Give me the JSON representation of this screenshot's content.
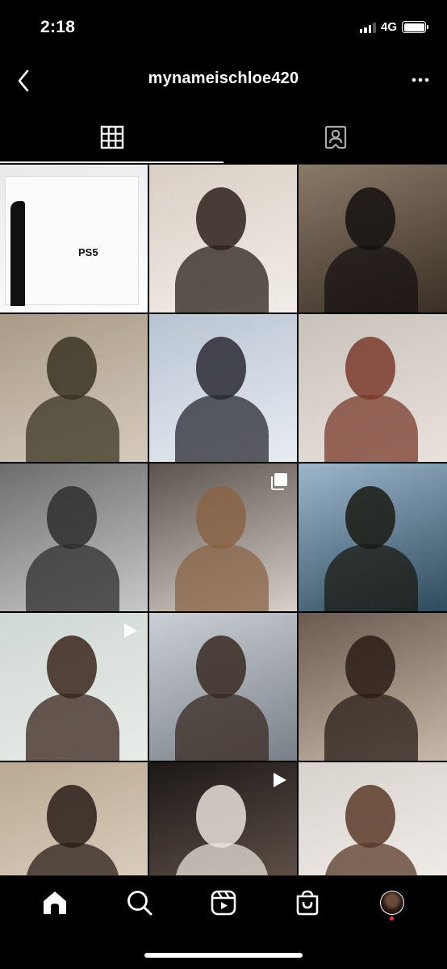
{
  "status_bar": {
    "time": "2:18",
    "network": "4G"
  },
  "header": {
    "title": "mynameischloe420",
    "back_icon": "chevron-left-icon",
    "more_icon": "more-horizontal-icon"
  },
  "tabs": [
    {
      "icon": "grid-icon",
      "active": true
    },
    {
      "icon": "tagged-person-icon",
      "active": false
    }
  ],
  "posts": [
    {
      "bg": [
        "#e9e9ec",
        "#ffffff"
      ],
      "figure": "#1a1a1a",
      "badge": null,
      "box_text": "PS5"
    },
    {
      "bg": [
        "#d9cfc4",
        "#f2ede8"
      ],
      "figure": "#2b201b",
      "badge": null
    },
    {
      "bg": [
        "#8a7a68",
        "#3a2f26"
      ],
      "figure": "#151210",
      "badge": null
    },
    {
      "bg": [
        "#a99a86",
        "#d5cbbd"
      ],
      "figure": "#3a3422",
      "badge": null
    },
    {
      "bg": [
        "#b8c4d2",
        "#e8ecf2"
      ],
      "figure": "#2a2a33",
      "badge": null
    },
    {
      "bg": [
        "#c9c2bb",
        "#e9e2dc"
      ],
      "figure": "#7a3b2c",
      "badge": null
    },
    {
      "bg": [
        "#6d6d6d",
        "#c8c8c8"
      ],
      "figure": "#2e2e2e",
      "badge": null
    },
    {
      "bg": [
        "#5c534d",
        "#d8cfc8"
      ],
      "figure": "#8a6447",
      "badge": "carousel-icon"
    },
    {
      "bg": [
        "#9cb6cc",
        "#2f4a5c"
      ],
      "figure": "#1b1b14",
      "badge": null
    },
    {
      "bg": [
        "#cfd8d5",
        "#e8ece8"
      ],
      "figure": "#3a261c",
      "badge": "reel-icon"
    },
    {
      "bg": [
        "#c9d0d5",
        "#7a8088"
      ],
      "figure": "#3a2a22",
      "badge": null
    },
    {
      "bg": [
        "#6a5a50",
        "#c8b8a8"
      ],
      "figure": "#2a1d18",
      "badge": null
    },
    {
      "bg": [
        "#b9a892",
        "#e0d4c4"
      ],
      "figure": "#2a1f19",
      "badge": null
    },
    {
      "bg": [
        "#1c1816",
        "#6a5a50"
      ],
      "figure": "#e6e0d8",
      "badge": "reel-icon"
    },
    {
      "bg": [
        "#d8d2cc",
        "#f4f0ec"
      ],
      "figure": "#5a3a28",
      "badge": null
    }
  ],
  "bottom_nav": [
    {
      "icon": "home-icon",
      "active": true
    },
    {
      "icon": "search-icon",
      "active": false
    },
    {
      "icon": "reels-icon",
      "active": false
    },
    {
      "icon": "shop-icon",
      "active": false
    },
    {
      "icon": "profile-avatar",
      "active": false
    }
  ]
}
